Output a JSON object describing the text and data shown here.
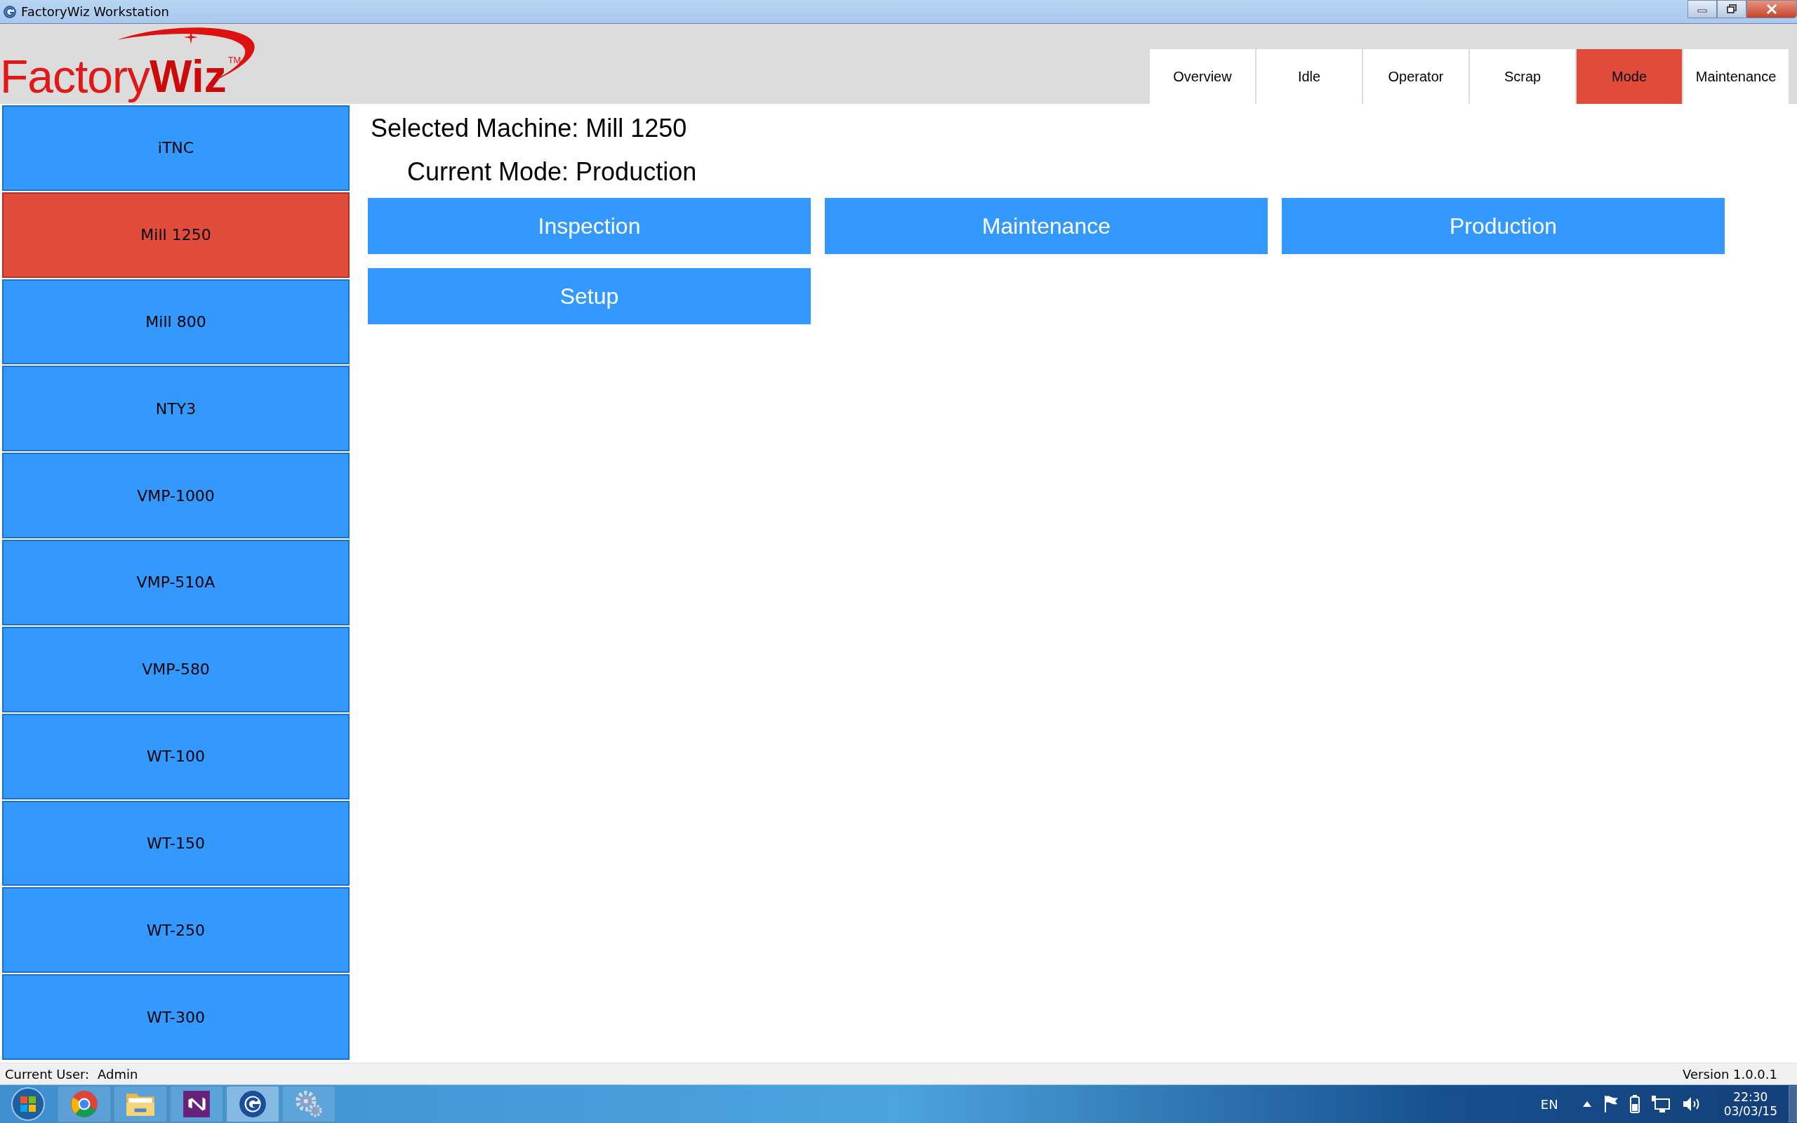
{
  "window": {
    "title": "FactoryWiz Workstation"
  },
  "logo": {
    "word": "Factory",
    "accent": "Wiz",
    "mark": "TM"
  },
  "tabs": [
    {
      "label": "Overview",
      "selected": false
    },
    {
      "label": "Idle",
      "selected": false
    },
    {
      "label": "Operator",
      "selected": false
    },
    {
      "label": "Scrap",
      "selected": false
    },
    {
      "label": "Mode",
      "selected": true
    },
    {
      "label": "Maintenance",
      "selected": false
    }
  ],
  "machines": [
    {
      "label": "iTNC",
      "selected": false
    },
    {
      "label": "Mill 1250",
      "selected": true
    },
    {
      "label": "Mill 800",
      "selected": false
    },
    {
      "label": "NTY3",
      "selected": false
    },
    {
      "label": "VMP-1000",
      "selected": false
    },
    {
      "label": "VMP-510A",
      "selected": false
    },
    {
      "label": "VMP-580",
      "selected": false
    },
    {
      "label": "WT-100",
      "selected": false
    },
    {
      "label": "WT-150",
      "selected": false
    },
    {
      "label": "WT-250",
      "selected": false
    },
    {
      "label": "WT-300",
      "selected": false
    }
  ],
  "selected_machine": "Selected Machine: Mill 1250",
  "current_mode": "Current Mode: Production",
  "mode_buttons": [
    "Inspection",
    "Maintenance",
    "Production",
    "Setup"
  ],
  "status_bar": {
    "user_label": "Current User:",
    "user": "Admin",
    "version": "Version 1.0.0.1"
  },
  "taskbar": {
    "language": "EN",
    "time": "22:30",
    "date": "03/03/15"
  }
}
